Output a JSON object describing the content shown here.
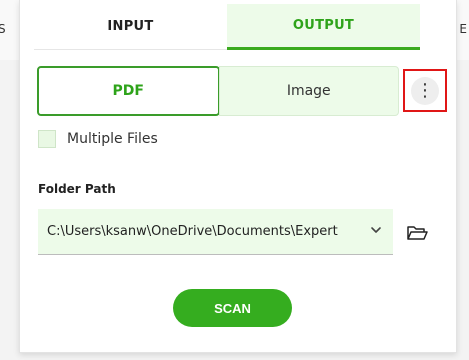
{
  "background": {
    "left_fragment": "S",
    "right_fragment": "E"
  },
  "tabs": [
    {
      "label": "INPUT",
      "active": false
    },
    {
      "label": "OUTPUT",
      "active": true
    }
  ],
  "format": {
    "options": [
      {
        "label": "PDF",
        "selected": true
      },
      {
        "label": "Image",
        "selected": false
      }
    ],
    "more_label": "⋮"
  },
  "multiple_files": {
    "label": "Multiple Files",
    "checked": false
  },
  "folder": {
    "label": "Folder Path",
    "path": "C:\\Users\\ksanw\\OneDrive\\Documents\\Expert"
  },
  "scan_label": "SCAN",
  "colors": {
    "accent": "#35ad1f",
    "accent_light": "#edfbe9",
    "highlight": "#e01616"
  },
  "icons": {
    "more": "more-vertical-icon",
    "dropdown": "chevron-down-icon",
    "folder": "folder-open-icon"
  }
}
